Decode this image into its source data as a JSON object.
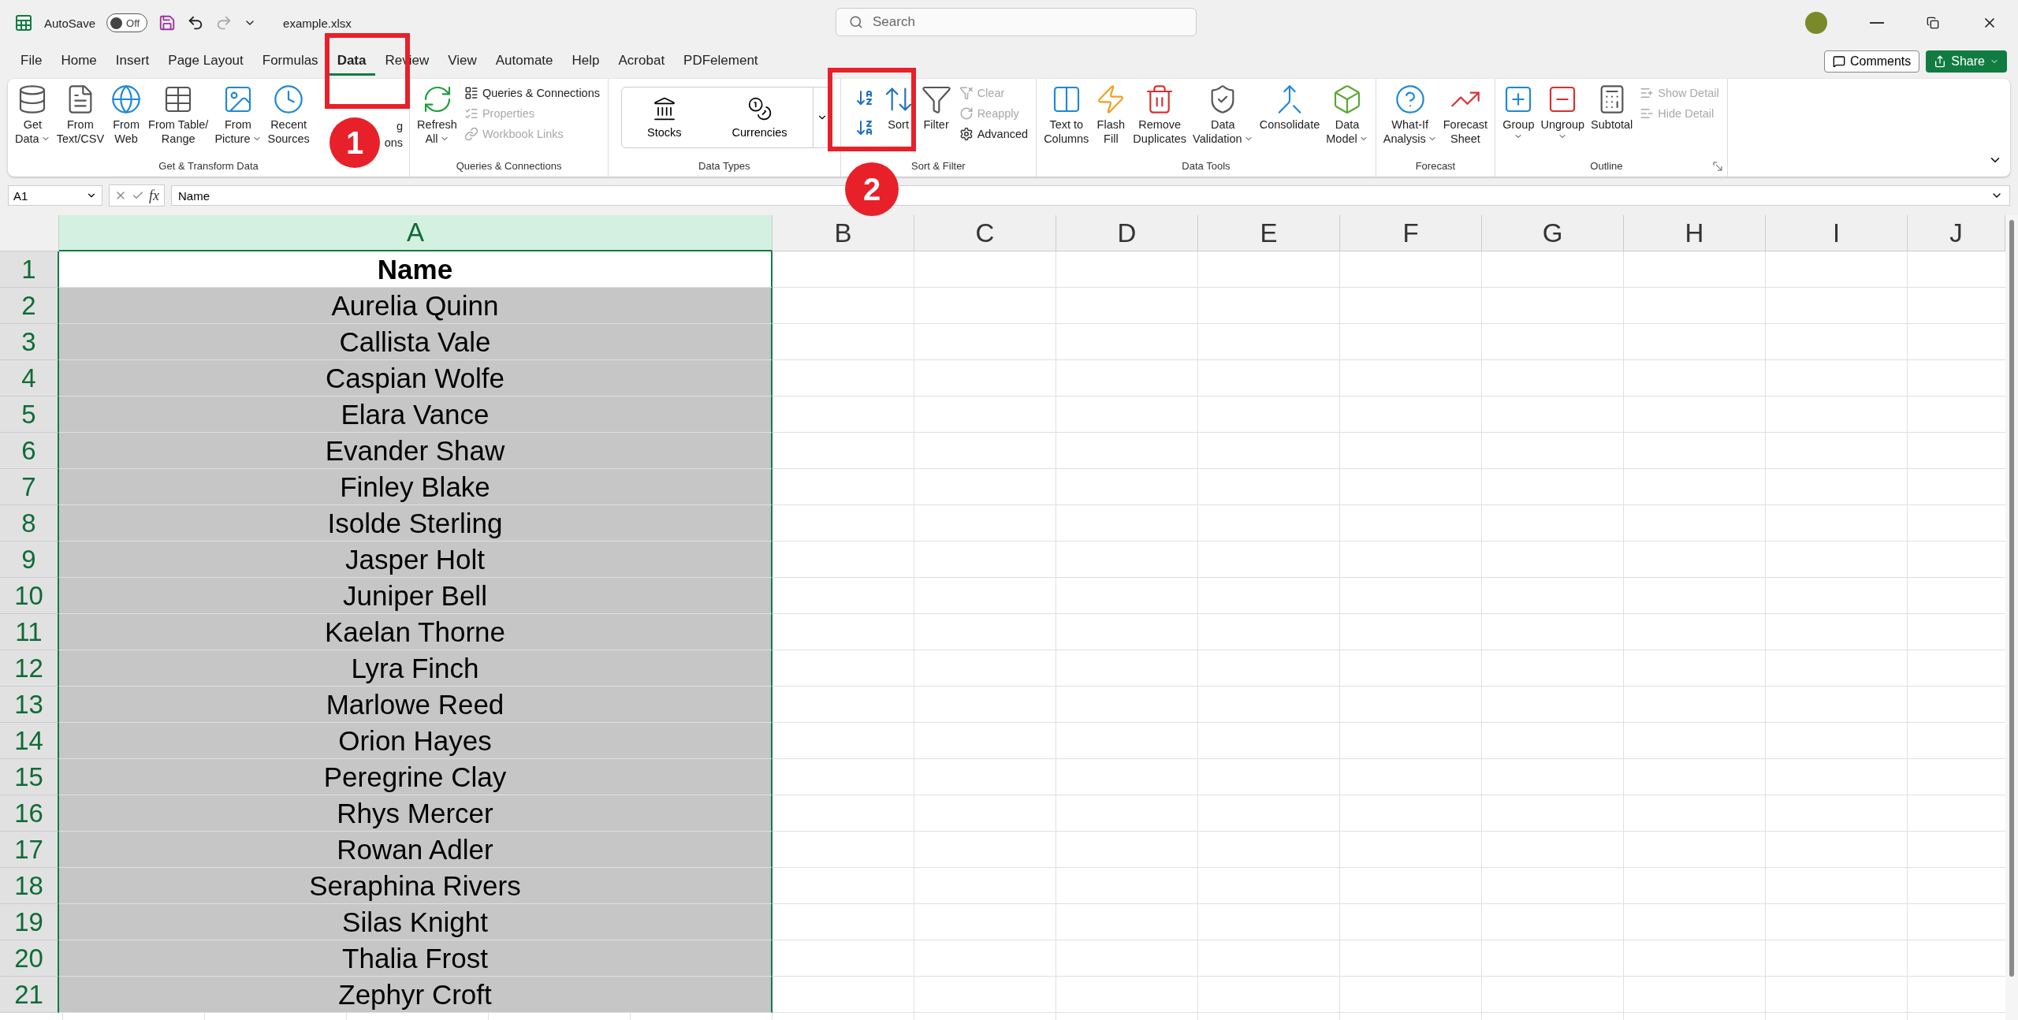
{
  "titlebar": {
    "autosave_label": "AutoSave",
    "autosave": {
      "on": false,
      "label": "Off"
    },
    "filename": "example.xlsx",
    "search": {
      "placeholder": "Search"
    }
  },
  "tabs": [
    {
      "label": "File",
      "selected": false
    },
    {
      "label": "Home",
      "selected": false
    },
    {
      "label": "Insert",
      "selected": false
    },
    {
      "label": "Page Layout",
      "selected": false
    },
    {
      "label": "Formulas",
      "selected": false
    },
    {
      "label": "Data",
      "selected": true
    },
    {
      "label": "Review",
      "selected": false
    },
    {
      "label": "View",
      "selected": false
    },
    {
      "label": "Automate",
      "selected": false
    },
    {
      "label": "Help",
      "selected": false
    },
    {
      "label": "Acrobat",
      "selected": false
    },
    {
      "label": "PDFelement",
      "selected": false
    }
  ],
  "actions": {
    "comments": "Comments",
    "share": "Share"
  },
  "ribbon": [
    {
      "title": "Get & Transform Data",
      "items": [
        {
          "kind": "large",
          "lines": [
            "Get",
            "Data"
          ],
          "dropdown": true
        },
        {
          "kind": "large",
          "lines": [
            "From",
            "Text/CSV"
          ],
          "dropdown": false
        },
        {
          "kind": "large",
          "lines": [
            "From",
            "Web"
          ],
          "dropdown": false
        },
        {
          "kind": "large",
          "lines": [
            "From Table/",
            "Range"
          ],
          "dropdown": false
        },
        {
          "kind": "large",
          "lines": [
            "From",
            "Picture"
          ],
          "dropdown": true
        },
        {
          "kind": "large",
          "lines": [
            "Recent",
            "Sources"
          ],
          "dropdown": false
        },
        {
          "kind": "covered",
          "lines": [
            "g",
            "ons"
          ]
        }
      ]
    },
    {
      "title": "Queries & Connections",
      "items": [
        {
          "kind": "large",
          "lines": [
            "Refresh",
            "All"
          ],
          "dropdown": true
        },
        {
          "kind": "stack",
          "entries": [
            {
              "label": "Queries & Connections",
              "disabled": false
            },
            {
              "label": "Properties",
              "disabled": true
            },
            {
              "label": "Workbook Links",
              "disabled": true
            }
          ]
        }
      ]
    },
    {
      "title": "Data Types",
      "items": [
        {
          "kind": "gallery",
          "entries": [
            {
              "label": "Stocks"
            },
            {
              "label": "Currencies"
            }
          ]
        }
      ]
    },
    {
      "title": "Sort & Filter",
      "items": [
        {
          "kind": "sortpair"
        },
        {
          "kind": "large",
          "lines": [
            "Sort"
          ],
          "dropdown": false
        },
        {
          "kind": "large",
          "lines": [
            "Filter"
          ],
          "dropdown": false
        },
        {
          "kind": "stack",
          "entries": [
            {
              "label": "Clear",
              "disabled": true
            },
            {
              "label": "Reapply",
              "disabled": true
            },
            {
              "label": "Advanced",
              "disabled": false
            }
          ]
        }
      ]
    },
    {
      "title": "Data Tools",
      "items": [
        {
          "kind": "large",
          "lines": [
            "Text to",
            "Columns"
          ],
          "dropdown": false
        },
        {
          "kind": "large",
          "lines": [
            "Flash",
            "Fill"
          ],
          "dropdown": false
        },
        {
          "kind": "large",
          "lines": [
            "Remove",
            "Duplicates"
          ],
          "dropdown": false
        },
        {
          "kind": "large",
          "lines": [
            "Data",
            "Validation"
          ],
          "dropdown": true
        },
        {
          "kind": "large",
          "lines": [
            "Consolidate"
          ],
          "dropdown": false
        },
        {
          "kind": "large",
          "lines": [
            "Data",
            "Model"
          ],
          "dropdown": true
        }
      ]
    },
    {
      "title": "Forecast",
      "items": [
        {
          "kind": "large",
          "lines": [
            "What-If",
            "Analysis"
          ],
          "dropdown": true
        },
        {
          "kind": "large",
          "lines": [
            "Forecast",
            "Sheet"
          ],
          "dropdown": false
        }
      ]
    },
    {
      "title": "Outline",
      "launcher": true,
      "items": [
        {
          "kind": "large",
          "lines": [
            "Group"
          ],
          "dropdown": true
        },
        {
          "kind": "large",
          "lines": [
            "Ungroup"
          ],
          "dropdown": true
        },
        {
          "kind": "large",
          "lines": [
            "Subtotal"
          ],
          "dropdown": false
        },
        {
          "kind": "stack",
          "entries": [
            {
              "label": "Show Detail",
              "disabled": true
            },
            {
              "label": "Hide Detail",
              "disabled": true
            }
          ]
        }
      ]
    }
  ],
  "formula_bar": {
    "name_box": "A1",
    "fx": "fx",
    "value": "Name"
  },
  "columns": [
    {
      "label": "A",
      "selected": true
    },
    {
      "label": "B",
      "selected": false
    },
    {
      "label": "C",
      "selected": false
    },
    {
      "label": "D",
      "selected": false
    },
    {
      "label": "E",
      "selected": false
    },
    {
      "label": "F",
      "selected": false
    },
    {
      "label": "G",
      "selected": false
    },
    {
      "label": "H",
      "selected": false
    },
    {
      "label": "I",
      "selected": false
    },
    {
      "label": "J",
      "selected": false
    }
  ],
  "rows": [
    {
      "number": "1",
      "selected": true,
      "kind": "header",
      "cell": "Name"
    },
    {
      "number": "2",
      "selected": true,
      "kind": "data",
      "cell": "Aurelia Quinn"
    },
    {
      "number": "3",
      "selected": true,
      "kind": "data",
      "cell": "Callista Vale"
    },
    {
      "number": "4",
      "selected": true,
      "kind": "data",
      "cell": "Caspian Wolfe"
    },
    {
      "number": "5",
      "selected": true,
      "kind": "data",
      "cell": "Elara Vance"
    },
    {
      "number": "6",
      "selected": true,
      "kind": "data",
      "cell": "Evander Shaw"
    },
    {
      "number": "7",
      "selected": true,
      "kind": "data",
      "cell": "Finley Blake"
    },
    {
      "number": "8",
      "selected": true,
      "kind": "data",
      "cell": "Isolde Sterling"
    },
    {
      "number": "9",
      "selected": true,
      "kind": "data",
      "cell": "Jasper Holt"
    },
    {
      "number": "10",
      "selected": true,
      "kind": "data",
      "cell": "Juniper Bell"
    },
    {
      "number": "11",
      "selected": true,
      "kind": "data",
      "cell": "Kaelan Thorne"
    },
    {
      "number": "12",
      "selected": true,
      "kind": "data",
      "cell": "Lyra Finch"
    },
    {
      "number": "13",
      "selected": true,
      "kind": "data",
      "cell": "Marlowe Reed"
    },
    {
      "number": "14",
      "selected": true,
      "kind": "data",
      "cell": "Orion Hayes"
    },
    {
      "number": "15",
      "selected": true,
      "kind": "data",
      "cell": "Peregrine Clay"
    },
    {
      "number": "16",
      "selected": true,
      "kind": "data",
      "cell": "Rhys Mercer"
    },
    {
      "number": "17",
      "selected": true,
      "kind": "data",
      "cell": "Rowan Adler"
    },
    {
      "number": "18",
      "selected": true,
      "kind": "data",
      "cell": "Seraphina Rivers"
    },
    {
      "number": "19",
      "selected": true,
      "kind": "data",
      "cell": "Silas Knight"
    },
    {
      "number": "20",
      "selected": true,
      "kind": "data",
      "cell": "Thalia Frost"
    },
    {
      "number": "21",
      "selected": true,
      "kind": "data",
      "cell": "Zephyr Croft"
    }
  ],
  "annotations": [
    {
      "label": "1"
    },
    {
      "label": "2"
    }
  ]
}
